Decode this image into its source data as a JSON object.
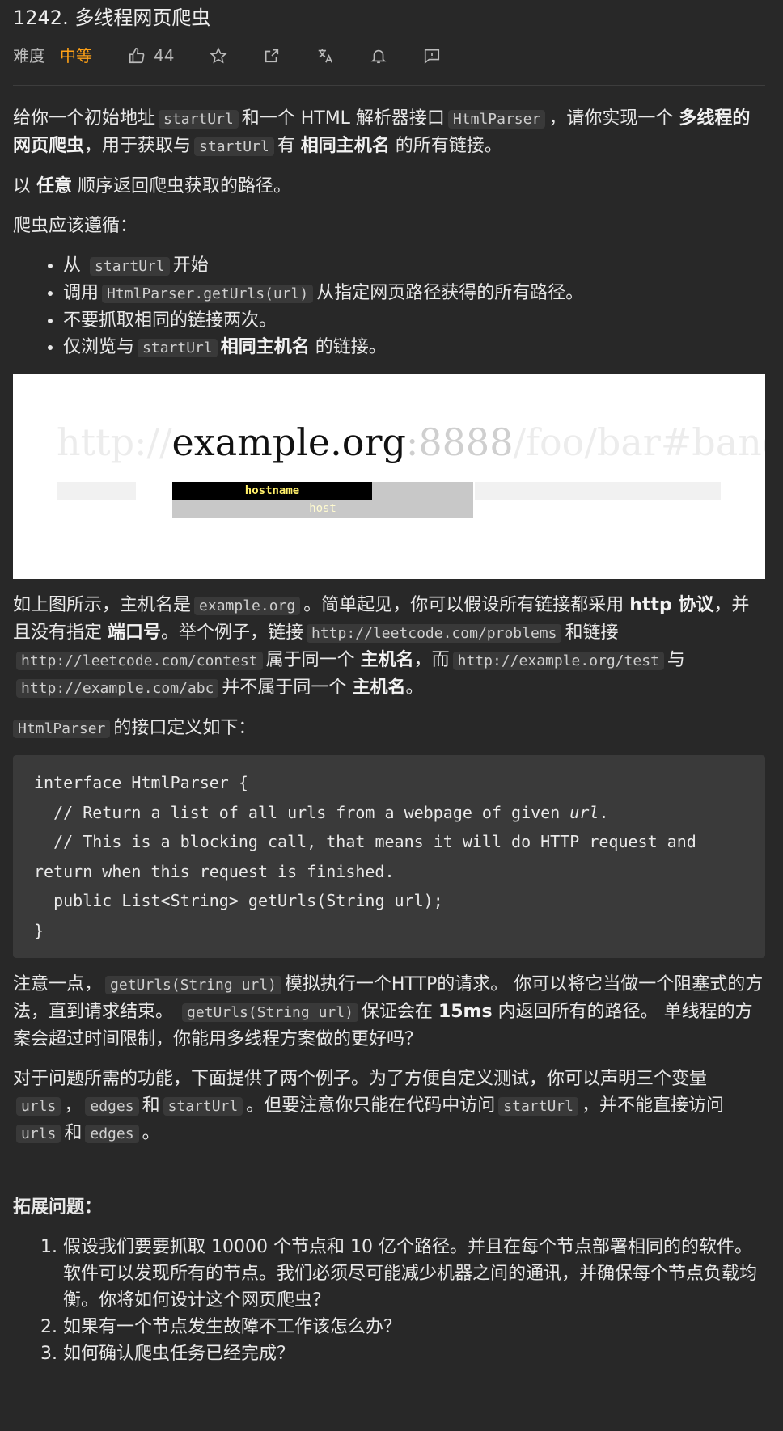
{
  "problem": {
    "title": "1242. 多线程网页爬虫",
    "difficulty_label": "难度",
    "difficulty": "中等",
    "likes": "44"
  },
  "icons": [
    "thumbs-up-icon",
    "star-icon",
    "share-icon",
    "translate-icon",
    "bell-icon",
    "feedback-icon"
  ],
  "colors": {
    "background": "#282828",
    "difficulty": "#ffa116",
    "code_bg": "#393939"
  },
  "desc": {
    "p1": {
      "t1": "给你一个初始地址",
      "c1": "startUrl",
      "t2": "和一个 HTML 解析器接口",
      "c2": "HtmlParser",
      "t3": "，请你实现一个",
      "b1": "多线程的网页爬虫",
      "t4": "，用于获取与",
      "c3": "startUrl",
      "t5": "有",
      "b2": "相同主机名",
      "t6": "的所有链接。"
    },
    "p2": {
      "t1": "以",
      "b1": "任意",
      "t2": "顺序返回爬虫获取的路径。"
    },
    "p3": "爬虫应该遵循：",
    "rules": {
      "r1_t1": "从",
      "r1_c1": "startUrl",
      "r1_t2": "开始",
      "r2_t1": "调用",
      "r2_c1": "HtmlParser.getUrls(url)",
      "r2_t2": "从指定网页路径获得的所有路径。",
      "r3": "不要抓取相同的链接两次。",
      "r4_t1": "仅浏览与",
      "r4_c1": "startUrl",
      "r4_b1": "相同主机名",
      "r4_t2": "的链接。"
    }
  },
  "figure": {
    "scheme": "http://",
    "host": "example.org",
    "port": ":8888",
    "path": "/foo/bar#bang",
    "hostname_label": "hostname",
    "host_label": "host"
  },
  "explain": {
    "t1": "如上图所示，主机名是",
    "c1": "example.org",
    "t2": "。简单起见，你可以假设所有链接都采用",
    "b1": "http 协议",
    "t3": "，并且没有指定",
    "b2": "端口号",
    "t4": "。举个例子，链接",
    "c2": "http://leetcode.com/problems",
    "t5": "和链接",
    "c3": "http://leetcode.com/contest",
    "t6": "属于同一个",
    "b3": "主机名",
    "t7": "，而",
    "c4": "http://example.org/test",
    "t8": "与",
    "c5": "http://example.com/abc",
    "t9": "并不属于同一个",
    "b4": "主机名",
    "t10": "。"
  },
  "iface": {
    "c1": "HtmlParser",
    "t1": "的接口定义如下："
  },
  "code": {
    "l1": "interface HtmlParser {",
    "l2a": "  // Return a list of all urls from a webpage of given ",
    "l2b": "url",
    "l2c": ".",
    "l3": "  // This is a blocking call, that means it will do HTTP request and return when this request is finished.",
    "l4": "  public List<String> getUrls(String url);",
    "l5": "}"
  },
  "note": {
    "t1": "注意一点，",
    "c1": "getUrls(String url)",
    "t2": "模拟执行一个HTTP的请求。 你可以将它当做一个阻塞式的方法，直到请求结束。",
    "c2": "getUrls(String url)",
    "t3": "保证会在",
    "b1": "15ms",
    "t4": "内返回所有的路径。 单线程的方案会超过时间限制，你能用多线程方案做的更好吗？"
  },
  "examples": {
    "t1": "对于问题所需的功能，下面提供了两个例子。为了方便自定义测试，你可以声明三个变量",
    "c1": "urls",
    "t2": "，",
    "c2": "edges",
    "t3": "和",
    "c3": "startUrl",
    "t4": "。但要注意你只能在代码中访问",
    "c4": "startUrl",
    "t5": "，并不能直接访问",
    "c5": "urls",
    "t6": "和",
    "c6": "edges",
    "t7": "。"
  },
  "followup": {
    "title": "拓展问题：",
    "q1": "假设我们要要抓取 10000 个节点和 10 亿个路径。并且在每个节点部署相同的的软件。软件可以发现所有的节点。我们必须尽可能减少机器之间的通讯，并确保每个节点负载均衡。你将如何设计这个网页爬虫？",
    "q2": "如果有一个节点发生故障不工作该怎么办？",
    "q3": "如何确认爬虫任务已经完成？"
  }
}
